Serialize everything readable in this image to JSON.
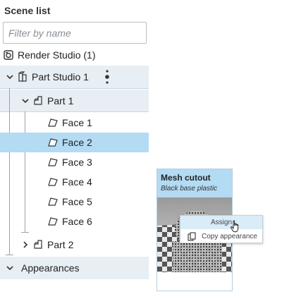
{
  "panel": {
    "heading": "Scene list",
    "filter_placeholder": "Filter by name"
  },
  "tree": {
    "render_studio": "Render Studio (1)",
    "part_studio": "Part Studio 1",
    "part1": "Part 1",
    "faces": [
      "Face 1",
      "Face 2",
      "Face 3",
      "Face 4",
      "Face 5",
      "Face 6"
    ],
    "selected_face": "Face 2",
    "part2": "Part 2",
    "appearances": "Appearances"
  },
  "card": {
    "title": "Mesh cutout",
    "subtitle": "Black base plastic"
  },
  "context_menu": {
    "assign": "Assign",
    "copy": "Copy appearance"
  },
  "colors": {
    "selected_row": "#b3dbf3",
    "group_band": "#e7eef4",
    "card_header": "#b3dbf3"
  }
}
